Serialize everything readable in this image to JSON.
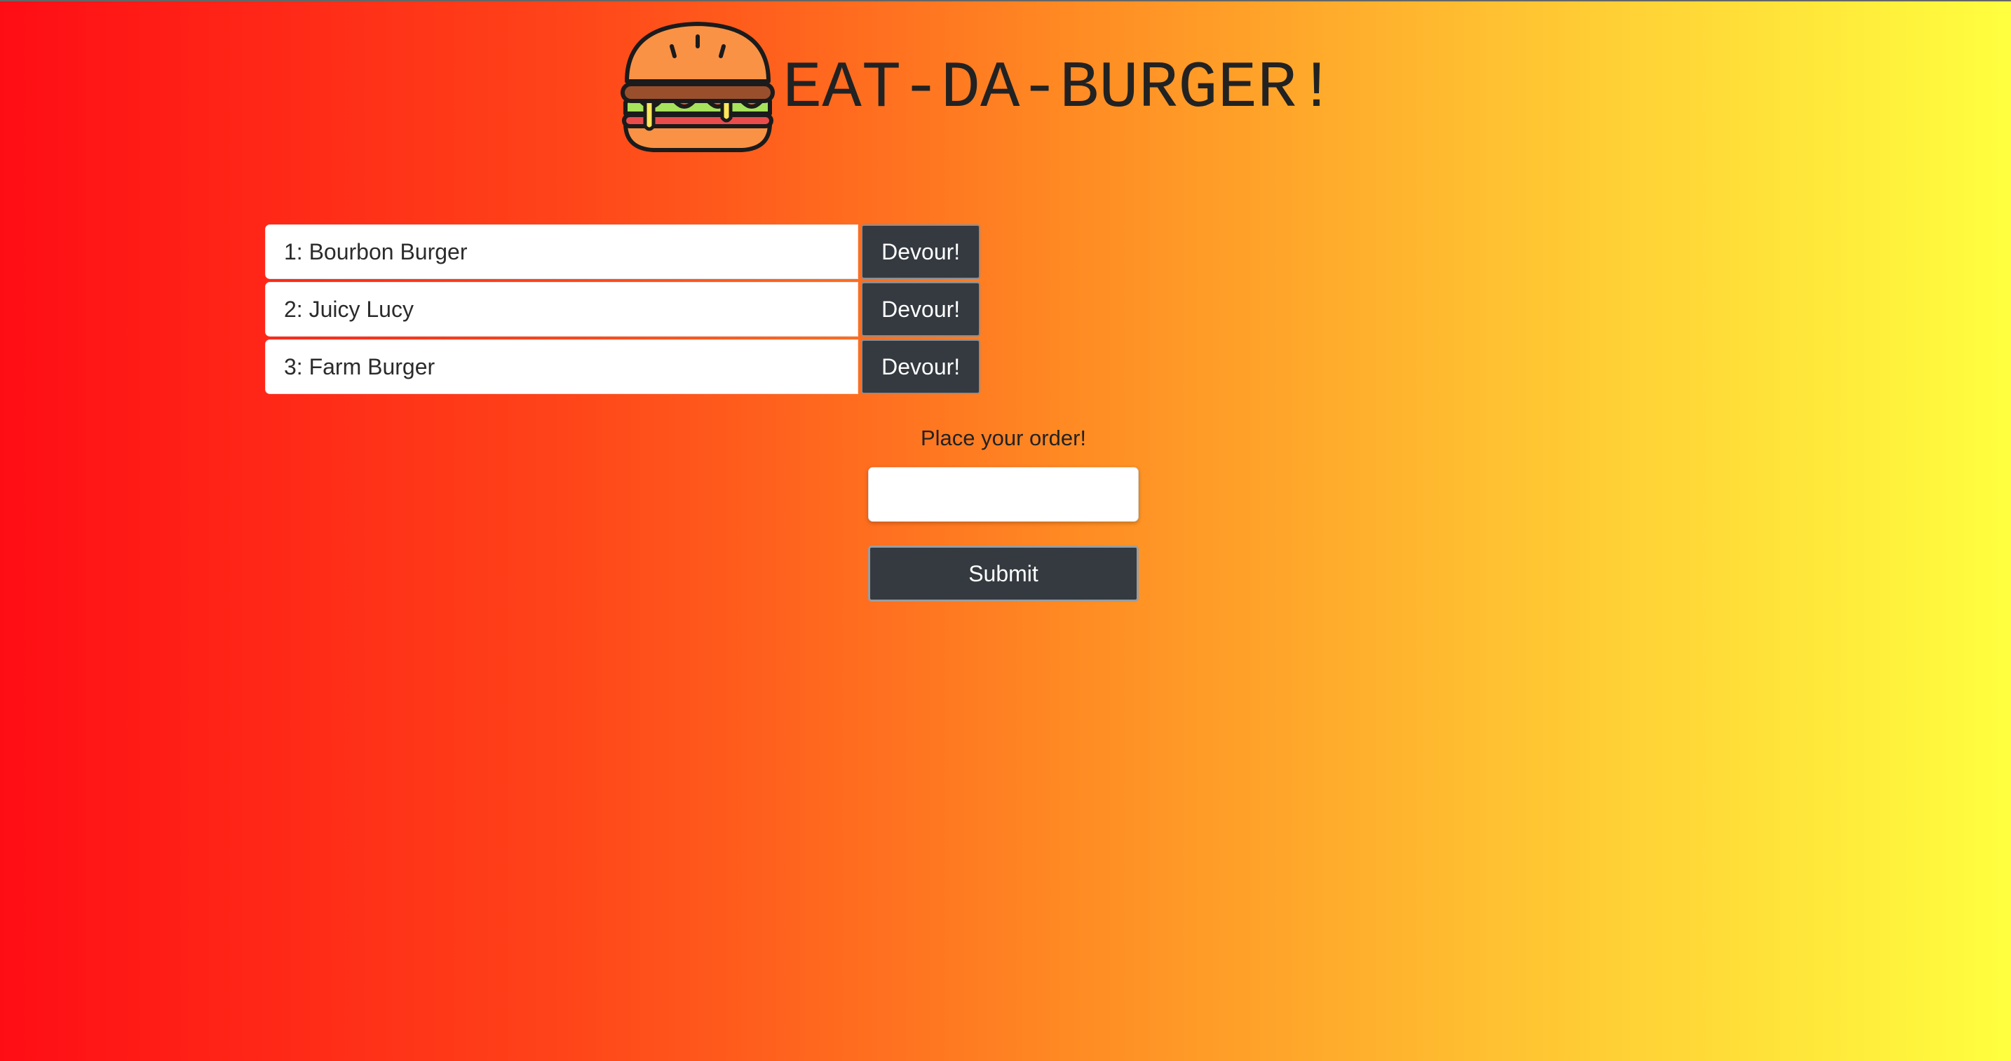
{
  "header": {
    "title": "EAT-DA-BURGER!",
    "logo_icon": "burger-icon"
  },
  "orders": [
    {
      "label": "1: Bourbon Burger",
      "button_label": "Devour!"
    },
    {
      "label": "2: Juicy Lucy",
      "button_label": "Devour!"
    },
    {
      "label": "3: Farm Burger",
      "button_label": "Devour!"
    }
  ],
  "order_form": {
    "label": "Place your order!",
    "input_value": "",
    "submit_label": "Submit"
  },
  "colors": {
    "gradient_left": "#ff0d15",
    "gradient_right": "#ffff3f",
    "button_dark": "#343a40",
    "title_text": "#222222"
  }
}
